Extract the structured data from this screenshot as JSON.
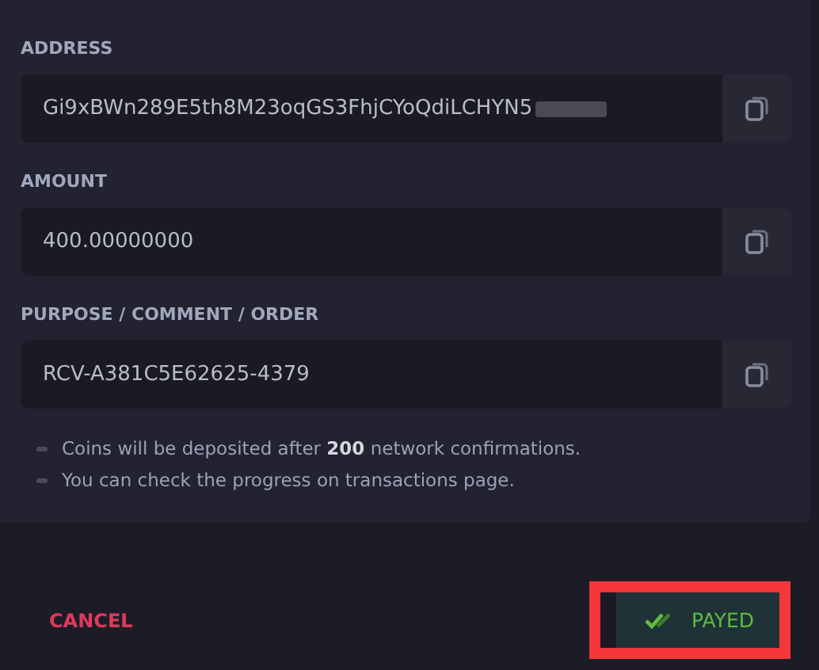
{
  "fields": [
    {
      "label": "ADDRESS",
      "value": "Gi9xBWn289E5th8M23oqGS3FhjCYoQdiLCHYN5",
      "redacted": true
    },
    {
      "label": "AMOUNT",
      "value": "400.00000000",
      "redacted": false
    },
    {
      "label": "PURPOSE / COMMENT / ORDER",
      "value": "RCV-A381C5E62625-4379",
      "redacted": false
    }
  ],
  "notes": [
    "Coins will be deposited after **200** network confirmations.",
    "You can check the progress on transactions page."
  ],
  "footer": {
    "cancel": "CANCEL",
    "confirm": {
      "label": "PAYED",
      "highlighted": true
    }
  }
}
